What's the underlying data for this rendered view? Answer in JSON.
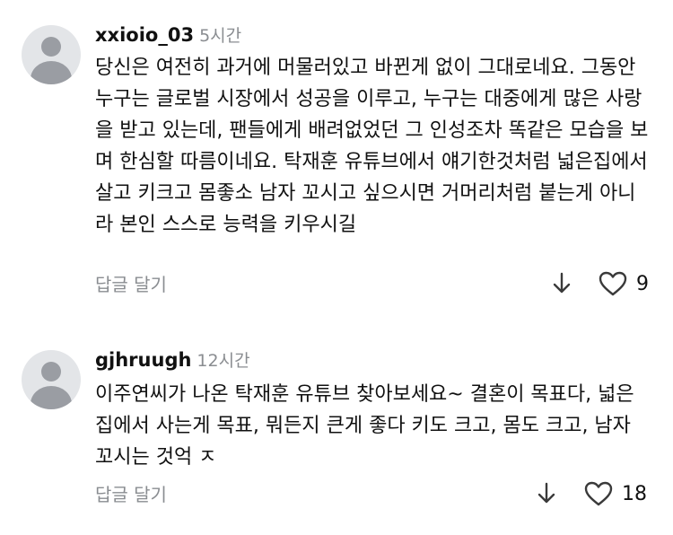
{
  "comments": [
    {
      "username": "xxioio_03",
      "time": "5시간",
      "text": "당신은 여전히 과거에 머물러있고 바뀐게 없이 그대로네요. 그동안 누구는 글로벌 시장에서 성공을 이루고, 누구는 대중에게 많은 사랑을 받고 있는데, 팬들에게 배려없었던 그 인성조차 똑같은 모습을 보며 한심할 따름이네요. 탁재훈 유튜브에서 얘기한것처럼 넓은집에서 살고 키크고 몸좋소 남자 꼬시고 싶으시면 거머리처럼 붙는게 아니라 본인 스스로 능력을 키우시길",
      "reply_label": "답글 달기",
      "likes": "9",
      "icons": {
        "avatar": "default-avatar",
        "down": "arrow-down-icon",
        "like": "heart-icon"
      }
    },
    {
      "username": "gjhruugh",
      "time": "12시간",
      "text": "이주연씨가 나온 탁재훈 유튜브 찾아보세요~  결혼이 목표다, 넓은집에서 사는게 목표, 뭐든지 큰게 좋다 키도 크고, 몸도 크고, 남자 꼬시는  것억 ㅈ",
      "reply_label": "답글 달기",
      "likes": "18",
      "icons": {
        "avatar": "default-avatar",
        "down": "arrow-down-icon",
        "like": "heart-icon"
      }
    }
  ],
  "colors": {
    "text": "#111111",
    "secondary": "#8a8d91",
    "avatar_bg": "#e3e5e8",
    "avatar_fg": "#9a9da3"
  }
}
